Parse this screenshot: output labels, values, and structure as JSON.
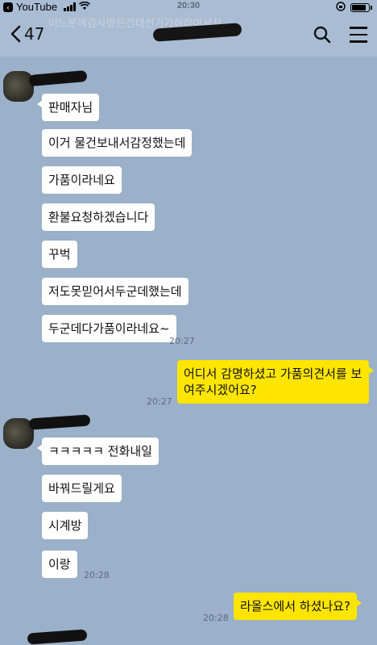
{
  "status_bar": {
    "back_app": "YouTube",
    "time": "20:30"
  },
  "header": {
    "back_count": "47",
    "faded_title": "어느분께검사받은건데선기가하하여셔서"
  },
  "messages": [
    {
      "side": "left",
      "text": "판매자님"
    },
    {
      "side": "left",
      "text": "이거 물건보내서감정했는데"
    },
    {
      "side": "left",
      "text": "가품이라네요"
    },
    {
      "side": "left",
      "text": "환불요청하겠습니다"
    },
    {
      "side": "left",
      "text": "꾸벅"
    },
    {
      "side": "left",
      "text": "저도못믿어서두군데했는데"
    },
    {
      "side": "left",
      "text": "두군데다가품이라네요~",
      "time": "20:27"
    },
    {
      "side": "right",
      "text": "어디서 감명하셨고 가품의견서를 보여주시겠어요?",
      "time": "20:27"
    },
    {
      "side": "left",
      "text": "ㅋㅋㅋㅋㅋ 전화내일"
    },
    {
      "side": "left",
      "text": "바꿔드릴게요"
    },
    {
      "side": "left",
      "text": "시계방"
    },
    {
      "side": "left",
      "text": "이랑",
      "time": "20:28"
    },
    {
      "side": "right",
      "text": "라올스에서 하셨나요?",
      "time": "20:28"
    }
  ]
}
